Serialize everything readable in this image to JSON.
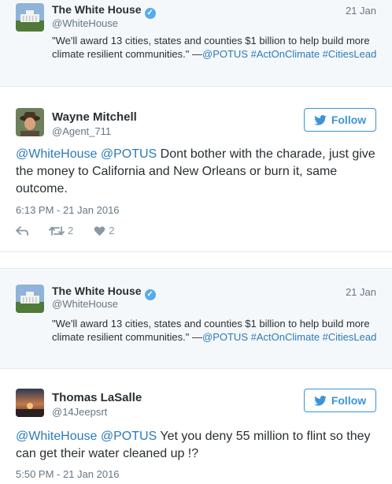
{
  "threads": [
    {
      "original": {
        "name": "The White House",
        "handle": "@WhiteHouse",
        "date": "21 Jan",
        "text_main": "\"We'll award 13 cities, states and counties $1 billion to help build more climate resilient communities.\" —",
        "mention": "@POTUS",
        "hashtag1": "#ActOnClimate",
        "hashtag2": "#CitiesLead"
      },
      "reply": {
        "name": "Wayne Mitchell",
        "handle": "@Agent_711",
        "follow_label": "Follow",
        "mention1": "@WhiteHouse",
        "mention2": "@POTUS",
        "text": " Dont bother with the charade, just give the money to California and New Orleans or burn it, same outcome.",
        "timestamp": "6:13 PM - 21 Jan 2016",
        "retweets": "2",
        "likes": "2"
      }
    },
    {
      "original": {
        "name": "The White House",
        "handle": "@WhiteHouse",
        "date": "21 Jan",
        "text_main": "\"We'll award 13 cities, states and counties $1 billion to help build more climate resilient communities.\" —",
        "mention": "@POTUS",
        "hashtag1": "#ActOnClimate",
        "hashtag2": "#CitiesLead"
      },
      "reply": {
        "name": "Thomas LaSalle",
        "handle": "@14Jeepsrt",
        "follow_label": "Follow",
        "mention1": "@WhiteHouse",
        "mention2": "@POTUS",
        "text": " Yet you deny 55 million to flint so they can get their water cleaned up !?",
        "timestamp": "5:50 PM - 21 Jan 2016"
      }
    }
  ],
  "icons": {
    "verified": "verified-badge-icon",
    "bird": "twitter-bird-icon",
    "reply": "reply-icon",
    "retweet": "retweet-icon",
    "like": "heart-icon"
  },
  "colors": {
    "link": "#2b7bb9",
    "follow": "#3b94d9",
    "verified": "#55acee",
    "context_bg": "#f5f8fa"
  }
}
